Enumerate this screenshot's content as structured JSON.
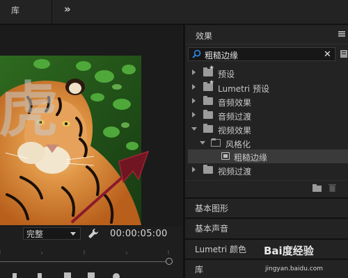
{
  "topbar": {
    "tab_library": "库",
    "more_glyph": "»"
  },
  "monitor": {
    "overlay_char": "虎",
    "fit_value": "完整",
    "timecode": "00:00:05:00"
  },
  "effects_panel": {
    "title": "效果",
    "search_value": "粗糙边缘",
    "clear_glyph": "✕",
    "tree": [
      {
        "label": "预设",
        "state": "collapsed",
        "icon": "preset-folder-icon"
      },
      {
        "label": "Lumetri 预设",
        "state": "collapsed",
        "icon": "preset-folder-icon"
      },
      {
        "label": "音频效果",
        "state": "collapsed",
        "icon": "folder-icon"
      },
      {
        "label": "音频过渡",
        "state": "collapsed",
        "icon": "folder-icon"
      },
      {
        "label": "视频效果",
        "state": "expanded",
        "icon": "folder-icon"
      },
      {
        "label": "风格化",
        "state": "expanded",
        "icon": "folder-outline-icon"
      },
      {
        "label": "粗糙边缘",
        "state": "selected",
        "icon": "effect-icon"
      },
      {
        "label": "视频过渡",
        "state": "collapsed",
        "icon": "folder-icon"
      }
    ]
  },
  "panel_tabs": [
    "基本图形",
    "基本声音",
    "Lumetri 颜色",
    "库"
  ],
  "watermark": {
    "main": "Bai度经验",
    "sub": "jingyan.baidu.com"
  },
  "colors": {
    "background": "#1e1e1e",
    "panel": "#232323",
    "selected_row": "#3a3a3a",
    "arrow": "#8b1a2a"
  }
}
